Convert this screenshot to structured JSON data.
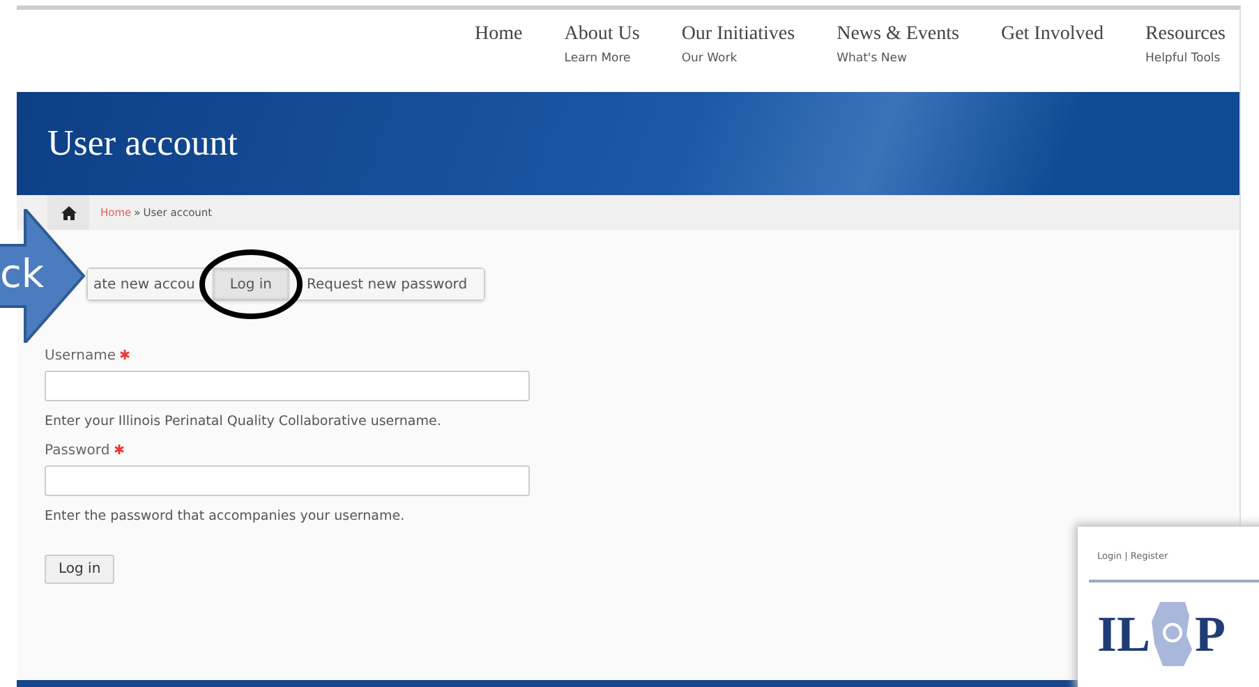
{
  "nav": [
    {
      "label": "Home"
    },
    {
      "label": "About Us",
      "sub": "Learn More"
    },
    {
      "label": "Our Initiatives",
      "sub": "Our Work"
    },
    {
      "label": "News & Events",
      "sub": "What's New"
    },
    {
      "label": "Get Involved"
    },
    {
      "label": "Resources",
      "sub": "Helpful Tools"
    }
  ],
  "banner": {
    "title": "User account"
  },
  "breadcrumb": {
    "link": "Home",
    "separator": "»",
    "current": "User account"
  },
  "tabs": [
    {
      "label": "ate new accou",
      "selected": false
    },
    {
      "label": "Log in",
      "selected": true
    },
    {
      "label": "Request new password",
      "selected": false
    }
  ],
  "form": {
    "fields": [
      {
        "label": "Username",
        "required": true,
        "description": "Enter your Illinois Perinatal Quality Collaborative username."
      },
      {
        "label": "Password",
        "required": true,
        "description": "Enter the password that accompanies your username."
      }
    ],
    "submit": "Log in"
  },
  "callout": {
    "text": "ck"
  },
  "inset": {
    "links": "Login | Register",
    "logo_left": "IL",
    "logo_right": "P"
  }
}
